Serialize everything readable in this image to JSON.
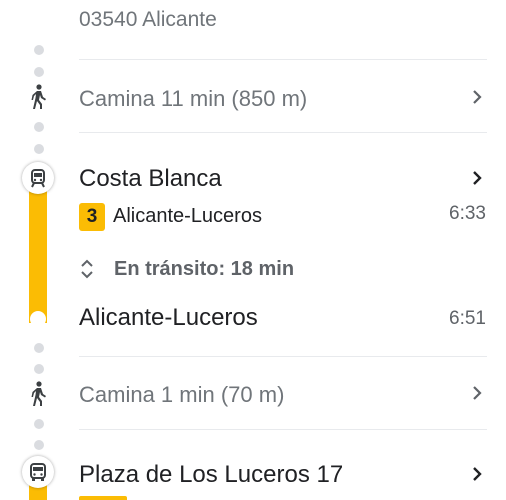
{
  "header": {
    "address": "03540 Alicante"
  },
  "walk1": {
    "label": "Camina 11 min (850 m)",
    "icon": "walking-icon"
  },
  "transit": {
    "board_stop": "Costa Blanca",
    "line_number": "3",
    "line_direction": "Alicante-Luceros",
    "depart_time": "6:33",
    "in_transit": "En tránsito: 18 min",
    "alight_stop": "Alicante-Luceros",
    "arrive_time": "6:51",
    "line_color": "#fbbc04",
    "icon": "tram-icon"
  },
  "walk2": {
    "label": "Camina 1 min (70 m)",
    "icon": "walking-icon"
  },
  "next": {
    "stop": "Plaza de Los Luceros 17",
    "icon": "bus-icon"
  }
}
